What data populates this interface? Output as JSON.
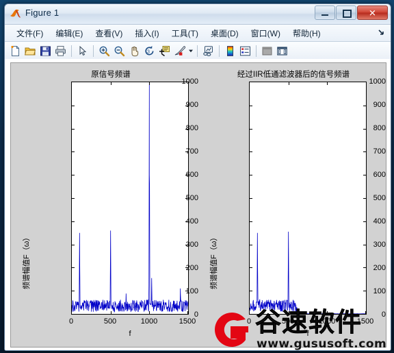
{
  "window": {
    "title": "Figure 1",
    "icon": "matlab-membrane-icon",
    "buttons": {
      "minimize": "–",
      "maximize": "□",
      "close": "✕"
    }
  },
  "menubar": {
    "items": [
      {
        "label": "文件(F)",
        "name": "menu-file"
      },
      {
        "label": "编辑(E)",
        "name": "menu-edit"
      },
      {
        "label": "查看(V)",
        "name": "menu-view"
      },
      {
        "label": "插入(I)",
        "name": "menu-insert"
      },
      {
        "label": "工具(T)",
        "name": "menu-tools"
      },
      {
        "label": "桌面(D)",
        "name": "menu-desktop"
      },
      {
        "label": "窗口(W)",
        "name": "menu-window"
      },
      {
        "label": "帮助(H)",
        "name": "menu-help"
      }
    ],
    "overflow_icon": "dock-arrow-icon"
  },
  "toolbar": {
    "items": [
      {
        "name": "new-figure-icon"
      },
      {
        "name": "open-file-icon"
      },
      {
        "name": "save-figure-icon"
      },
      {
        "name": "print-figure-icon"
      },
      {
        "sep": true
      },
      {
        "name": "pointer-icon"
      },
      {
        "sep": true
      },
      {
        "name": "zoom-in-icon"
      },
      {
        "name": "zoom-out-icon"
      },
      {
        "name": "pan-icon"
      },
      {
        "name": "rotate-3d-icon"
      },
      {
        "name": "data-cursor-icon"
      },
      {
        "name": "brush-icon"
      },
      {
        "name": "brush-dropdown-caret-icon"
      },
      {
        "sep": true
      },
      {
        "name": "link-data-icon"
      },
      {
        "sep": true
      },
      {
        "name": "colorbar-icon"
      },
      {
        "name": "legend-icon"
      },
      {
        "sep": true
      },
      {
        "name": "hide-plot-tools-icon"
      },
      {
        "name": "show-plot-tools-icon"
      }
    ]
  },
  "watermark": {
    "brand": "谷速软件",
    "url": "www.gususoft.com",
    "logo": "gususoft-g-logo",
    "logo_color": "#e30613"
  },
  "chart_data": [
    {
      "type": "line",
      "name": "original-spectrum",
      "title": "原信号频谱",
      "xlabel": "f",
      "ylabel": "频谱幅值F（ω）",
      "xlim": [
        0,
        1500
      ],
      "ylim": [
        0,
        1000
      ],
      "xticks": [
        0,
        500,
        1000,
        1500
      ],
      "yticks": [
        0,
        100,
        200,
        300,
        400,
        500,
        600,
        700,
        800,
        900,
        1000
      ],
      "grid": false,
      "line_color": "#0000c8",
      "noise_floor": 35,
      "peaks": [
        {
          "x": 100,
          "y": 350
        },
        {
          "x": 500,
          "y": 360
        },
        {
          "x": 1000,
          "y": 1000
        },
        {
          "x": 1000,
          "y": 600
        },
        {
          "x": 1030,
          "y": 155
        },
        {
          "x": 1400,
          "y": 110
        },
        {
          "x": 700,
          "y": 88
        }
      ]
    },
    {
      "type": "line",
      "name": "iir-filtered-spectrum",
      "title": "经过IIR低通滤波器后的信号频谱",
      "xlabel": "f",
      "ylabel": "频谱幅值F（ω）",
      "xlim": [
        0,
        1500
      ],
      "ylim": [
        0,
        1000
      ],
      "xticks": [
        0,
        500,
        1000,
        1500
      ],
      "yticks": [
        0,
        100,
        200,
        300,
        400,
        500,
        600,
        700,
        800,
        900,
        1000
      ],
      "grid": false,
      "line_color": "#0000c8",
      "noise_floor": 35,
      "cutoff": 600,
      "peaks": [
        {
          "x": 100,
          "y": 350
        },
        {
          "x": 500,
          "y": 355
        }
      ]
    }
  ]
}
